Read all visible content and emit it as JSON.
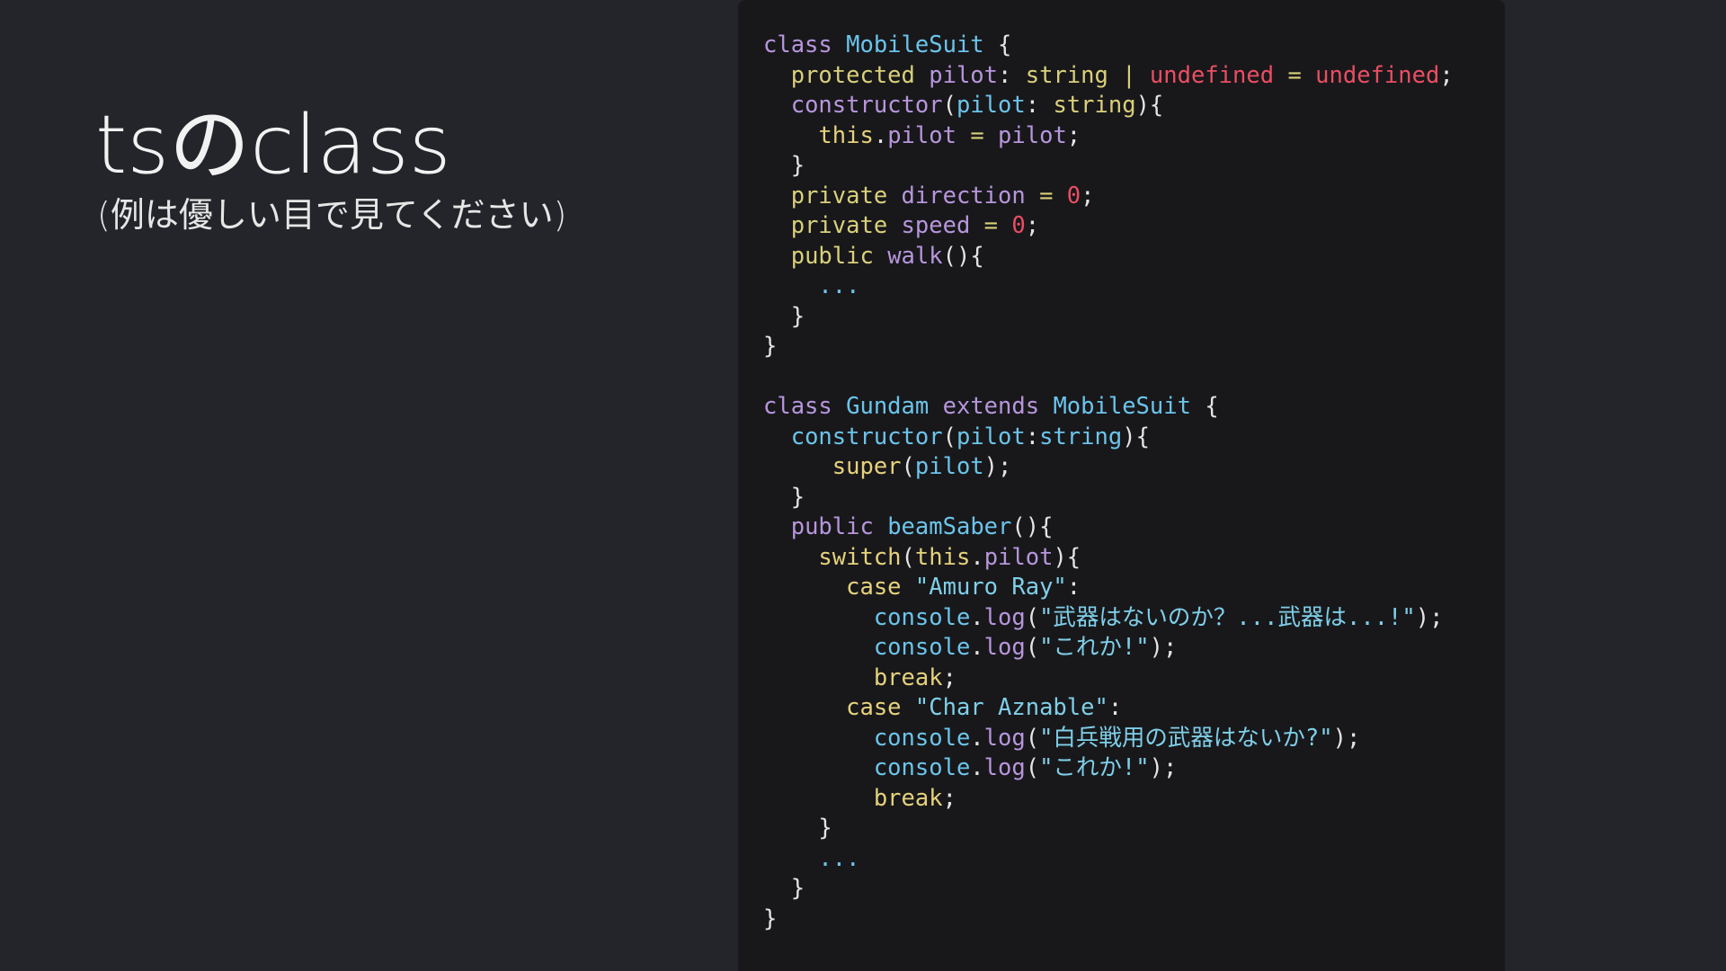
{
  "slide": {
    "title": "tsのclass",
    "subtitle": "(例は優しい目で見てください)"
  },
  "colors": {
    "background": "#23252a",
    "code_background": "#18181b",
    "plain": "#e4e4e4",
    "keyword": "#b796dc",
    "class_name": "#6cc4ea",
    "type": "#d9d07a",
    "red": "#ea4e62",
    "yellow": "#e6d27c",
    "string": "#7fcfe8"
  },
  "code": {
    "lines": [
      [
        {
          "t": "class ",
          "c": "keyword"
        },
        {
          "t": "MobileSuit",
          "c": "class"
        },
        {
          "t": " {",
          "c": "plain"
        }
      ],
      [
        {
          "t": "  ",
          "c": "plain"
        },
        {
          "t": "protected",
          "c": "type"
        },
        {
          "t": " ",
          "c": "plain"
        },
        {
          "t": "pilot",
          "c": "prop"
        },
        {
          "t": ": ",
          "c": "plain"
        },
        {
          "t": "string",
          "c": "type"
        },
        {
          "t": " | ",
          "c": "type"
        },
        {
          "t": "undefined",
          "c": "red"
        },
        {
          "t": " = ",
          "c": "type"
        },
        {
          "t": "undefined",
          "c": "red"
        },
        {
          "t": ";",
          "c": "plain"
        }
      ],
      [
        {
          "t": "  ",
          "c": "plain"
        },
        {
          "t": "constructor",
          "c": "prop"
        },
        {
          "t": "(",
          "c": "plain"
        },
        {
          "t": "pilot",
          "c": "blue"
        },
        {
          "t": ": ",
          "c": "plain"
        },
        {
          "t": "string",
          "c": "type"
        },
        {
          "t": "){",
          "c": "plain"
        }
      ],
      [
        {
          "t": "    ",
          "c": "plain"
        },
        {
          "t": "this",
          "c": "yellow"
        },
        {
          "t": ".",
          "c": "plain"
        },
        {
          "t": "pilot",
          "c": "prop"
        },
        {
          "t": " = ",
          "c": "type"
        },
        {
          "t": "pilot",
          "c": "prop"
        },
        {
          "t": ";",
          "c": "plain"
        }
      ],
      [
        {
          "t": "  }",
          "c": "plain"
        }
      ],
      [
        {
          "t": "  ",
          "c": "plain"
        },
        {
          "t": "private",
          "c": "type"
        },
        {
          "t": " ",
          "c": "plain"
        },
        {
          "t": "direction",
          "c": "prop"
        },
        {
          "t": " = ",
          "c": "type"
        },
        {
          "t": "0",
          "c": "num"
        },
        {
          "t": ";",
          "c": "plain"
        }
      ],
      [
        {
          "t": "  ",
          "c": "plain"
        },
        {
          "t": "private",
          "c": "type"
        },
        {
          "t": " ",
          "c": "plain"
        },
        {
          "t": "speed",
          "c": "prop"
        },
        {
          "t": " = ",
          "c": "type"
        },
        {
          "t": "0",
          "c": "num"
        },
        {
          "t": ";",
          "c": "plain"
        }
      ],
      [
        {
          "t": "  ",
          "c": "plain"
        },
        {
          "t": "public",
          "c": "type"
        },
        {
          "t": " ",
          "c": "plain"
        },
        {
          "t": "walk",
          "c": "prop"
        },
        {
          "t": "(){",
          "c": "plain"
        }
      ],
      [
        {
          "t": "    ",
          "c": "plain"
        },
        {
          "t": "...",
          "c": "blue"
        }
      ],
      [
        {
          "t": "  }",
          "c": "plain"
        }
      ],
      [
        {
          "t": "}",
          "c": "plain"
        }
      ],
      [
        {
          "t": "",
          "c": "plain"
        }
      ],
      [
        {
          "t": "class ",
          "c": "keyword"
        },
        {
          "t": "Gundam",
          "c": "class"
        },
        {
          "t": " ",
          "c": "plain"
        },
        {
          "t": "extends",
          "c": "keyword"
        },
        {
          "t": " ",
          "c": "plain"
        },
        {
          "t": "MobileSuit",
          "c": "class"
        },
        {
          "t": " {",
          "c": "plain"
        }
      ],
      [
        {
          "t": "  ",
          "c": "plain"
        },
        {
          "t": "constructor",
          "c": "class"
        },
        {
          "t": "(",
          "c": "plain"
        },
        {
          "t": "pilot",
          "c": "blue"
        },
        {
          "t": ":",
          "c": "plain"
        },
        {
          "t": "string",
          "c": "blue"
        },
        {
          "t": "){",
          "c": "plain"
        }
      ],
      [
        {
          "t": "     ",
          "c": "plain"
        },
        {
          "t": "super",
          "c": "yellow"
        },
        {
          "t": "(",
          "c": "plain"
        },
        {
          "t": "pilot",
          "c": "blue"
        },
        {
          "t": ");",
          "c": "plain"
        }
      ],
      [
        {
          "t": "  }",
          "c": "plain"
        }
      ],
      [
        {
          "t": "  ",
          "c": "plain"
        },
        {
          "t": "public",
          "c": "keyword"
        },
        {
          "t": " ",
          "c": "plain"
        },
        {
          "t": "beamSaber",
          "c": "class"
        },
        {
          "t": "(){",
          "c": "plain"
        }
      ],
      [
        {
          "t": "    ",
          "c": "plain"
        },
        {
          "t": "switch",
          "c": "yellow"
        },
        {
          "t": "(",
          "c": "plain"
        },
        {
          "t": "this",
          "c": "yellow"
        },
        {
          "t": ".",
          "c": "plain"
        },
        {
          "t": "pilot",
          "c": "prop"
        },
        {
          "t": "){",
          "c": "plain"
        }
      ],
      [
        {
          "t": "      ",
          "c": "plain"
        },
        {
          "t": "case",
          "c": "yellow"
        },
        {
          "t": " ",
          "c": "plain"
        },
        {
          "t": "\"Amuro Ray\"",
          "c": "string"
        },
        {
          "t": ":",
          "c": "plain"
        }
      ],
      [
        {
          "t": "        ",
          "c": "plain"
        },
        {
          "t": "console",
          "c": "blue"
        },
        {
          "t": ".",
          "c": "plain"
        },
        {
          "t": "log",
          "c": "prop"
        },
        {
          "t": "(",
          "c": "plain"
        },
        {
          "t": "\"武器はないのか？...武器は...!\"",
          "c": "string"
        },
        {
          "t": ");",
          "c": "plain"
        }
      ],
      [
        {
          "t": "        ",
          "c": "plain"
        },
        {
          "t": "console",
          "c": "blue"
        },
        {
          "t": ".",
          "c": "plain"
        },
        {
          "t": "log",
          "c": "prop"
        },
        {
          "t": "(",
          "c": "plain"
        },
        {
          "t": "\"これか!\"",
          "c": "string"
        },
        {
          "t": ");",
          "c": "plain"
        }
      ],
      [
        {
          "t": "        ",
          "c": "plain"
        },
        {
          "t": "break",
          "c": "yellow"
        },
        {
          "t": ";",
          "c": "plain"
        }
      ],
      [
        {
          "t": "      ",
          "c": "plain"
        },
        {
          "t": "case",
          "c": "yellow"
        },
        {
          "t": " ",
          "c": "plain"
        },
        {
          "t": "\"Char Aznable\"",
          "c": "string"
        },
        {
          "t": ":",
          "c": "plain"
        }
      ],
      [
        {
          "t": "        ",
          "c": "plain"
        },
        {
          "t": "console",
          "c": "blue"
        },
        {
          "t": ".",
          "c": "plain"
        },
        {
          "t": "log",
          "c": "prop"
        },
        {
          "t": "(",
          "c": "plain"
        },
        {
          "t": "\"白兵戦用の武器はないか?\"",
          "c": "string"
        },
        {
          "t": ");",
          "c": "plain"
        }
      ],
      [
        {
          "t": "        ",
          "c": "plain"
        },
        {
          "t": "console",
          "c": "blue"
        },
        {
          "t": ".",
          "c": "plain"
        },
        {
          "t": "log",
          "c": "prop"
        },
        {
          "t": "(",
          "c": "plain"
        },
        {
          "t": "\"これか!\"",
          "c": "string"
        },
        {
          "t": ");",
          "c": "plain"
        }
      ],
      [
        {
          "t": "        ",
          "c": "plain"
        },
        {
          "t": "break",
          "c": "yellow"
        },
        {
          "t": ";",
          "c": "plain"
        }
      ],
      [
        {
          "t": "    }",
          "c": "plain"
        }
      ],
      [
        {
          "t": "    ",
          "c": "plain"
        },
        {
          "t": "...",
          "c": "blue"
        }
      ],
      [
        {
          "t": "  }",
          "c": "plain"
        }
      ],
      [
        {
          "t": "}",
          "c": "plain"
        }
      ]
    ]
  }
}
